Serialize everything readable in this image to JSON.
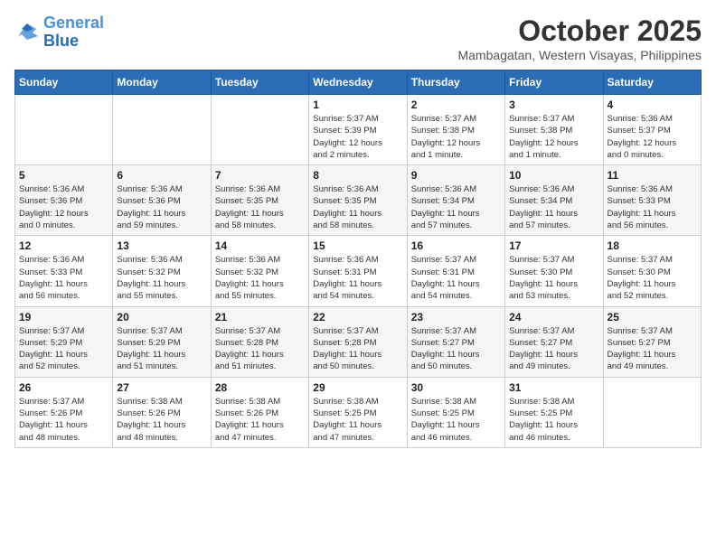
{
  "logo": {
    "line1": "General",
    "line2": "Blue"
  },
  "title": "October 2025",
  "subtitle": "Mambagatan, Western Visayas, Philippines",
  "headers": [
    "Sunday",
    "Monday",
    "Tuesday",
    "Wednesday",
    "Thursday",
    "Friday",
    "Saturday"
  ],
  "weeks": [
    [
      {
        "day": "",
        "info": ""
      },
      {
        "day": "",
        "info": ""
      },
      {
        "day": "",
        "info": ""
      },
      {
        "day": "1",
        "info": "Sunrise: 5:37 AM\nSunset: 5:39 PM\nDaylight: 12 hours\nand 2 minutes."
      },
      {
        "day": "2",
        "info": "Sunrise: 5:37 AM\nSunset: 5:38 PM\nDaylight: 12 hours\nand 1 minute."
      },
      {
        "day": "3",
        "info": "Sunrise: 5:37 AM\nSunset: 5:38 PM\nDaylight: 12 hours\nand 1 minute."
      },
      {
        "day": "4",
        "info": "Sunrise: 5:36 AM\nSunset: 5:37 PM\nDaylight: 12 hours\nand 0 minutes."
      }
    ],
    [
      {
        "day": "5",
        "info": "Sunrise: 5:36 AM\nSunset: 5:36 PM\nDaylight: 12 hours\nand 0 minutes."
      },
      {
        "day": "6",
        "info": "Sunrise: 5:36 AM\nSunset: 5:36 PM\nDaylight: 11 hours\nand 59 minutes."
      },
      {
        "day": "7",
        "info": "Sunrise: 5:36 AM\nSunset: 5:35 PM\nDaylight: 11 hours\nand 58 minutes."
      },
      {
        "day": "8",
        "info": "Sunrise: 5:36 AM\nSunset: 5:35 PM\nDaylight: 11 hours\nand 58 minutes."
      },
      {
        "day": "9",
        "info": "Sunrise: 5:36 AM\nSunset: 5:34 PM\nDaylight: 11 hours\nand 57 minutes."
      },
      {
        "day": "10",
        "info": "Sunrise: 5:36 AM\nSunset: 5:34 PM\nDaylight: 11 hours\nand 57 minutes."
      },
      {
        "day": "11",
        "info": "Sunrise: 5:36 AM\nSunset: 5:33 PM\nDaylight: 11 hours\nand 56 minutes."
      }
    ],
    [
      {
        "day": "12",
        "info": "Sunrise: 5:36 AM\nSunset: 5:33 PM\nDaylight: 11 hours\nand 56 minutes."
      },
      {
        "day": "13",
        "info": "Sunrise: 5:36 AM\nSunset: 5:32 PM\nDaylight: 11 hours\nand 55 minutes."
      },
      {
        "day": "14",
        "info": "Sunrise: 5:36 AM\nSunset: 5:32 PM\nDaylight: 11 hours\nand 55 minutes."
      },
      {
        "day": "15",
        "info": "Sunrise: 5:36 AM\nSunset: 5:31 PM\nDaylight: 11 hours\nand 54 minutes."
      },
      {
        "day": "16",
        "info": "Sunrise: 5:37 AM\nSunset: 5:31 PM\nDaylight: 11 hours\nand 54 minutes."
      },
      {
        "day": "17",
        "info": "Sunrise: 5:37 AM\nSunset: 5:30 PM\nDaylight: 11 hours\nand 53 minutes."
      },
      {
        "day": "18",
        "info": "Sunrise: 5:37 AM\nSunset: 5:30 PM\nDaylight: 11 hours\nand 52 minutes."
      }
    ],
    [
      {
        "day": "19",
        "info": "Sunrise: 5:37 AM\nSunset: 5:29 PM\nDaylight: 11 hours\nand 52 minutes."
      },
      {
        "day": "20",
        "info": "Sunrise: 5:37 AM\nSunset: 5:29 PM\nDaylight: 11 hours\nand 51 minutes."
      },
      {
        "day": "21",
        "info": "Sunrise: 5:37 AM\nSunset: 5:28 PM\nDaylight: 11 hours\nand 51 minutes."
      },
      {
        "day": "22",
        "info": "Sunrise: 5:37 AM\nSunset: 5:28 PM\nDaylight: 11 hours\nand 50 minutes."
      },
      {
        "day": "23",
        "info": "Sunrise: 5:37 AM\nSunset: 5:27 PM\nDaylight: 11 hours\nand 50 minutes."
      },
      {
        "day": "24",
        "info": "Sunrise: 5:37 AM\nSunset: 5:27 PM\nDaylight: 11 hours\nand 49 minutes."
      },
      {
        "day": "25",
        "info": "Sunrise: 5:37 AM\nSunset: 5:27 PM\nDaylight: 11 hours\nand 49 minutes."
      }
    ],
    [
      {
        "day": "26",
        "info": "Sunrise: 5:37 AM\nSunset: 5:26 PM\nDaylight: 11 hours\nand 48 minutes."
      },
      {
        "day": "27",
        "info": "Sunrise: 5:38 AM\nSunset: 5:26 PM\nDaylight: 11 hours\nand 48 minutes."
      },
      {
        "day": "28",
        "info": "Sunrise: 5:38 AM\nSunset: 5:26 PM\nDaylight: 11 hours\nand 47 minutes."
      },
      {
        "day": "29",
        "info": "Sunrise: 5:38 AM\nSunset: 5:25 PM\nDaylight: 11 hours\nand 47 minutes."
      },
      {
        "day": "30",
        "info": "Sunrise: 5:38 AM\nSunset: 5:25 PM\nDaylight: 11 hours\nand 46 minutes."
      },
      {
        "day": "31",
        "info": "Sunrise: 5:38 AM\nSunset: 5:25 PM\nDaylight: 11 hours\nand 46 minutes."
      },
      {
        "day": "",
        "info": ""
      }
    ]
  ]
}
